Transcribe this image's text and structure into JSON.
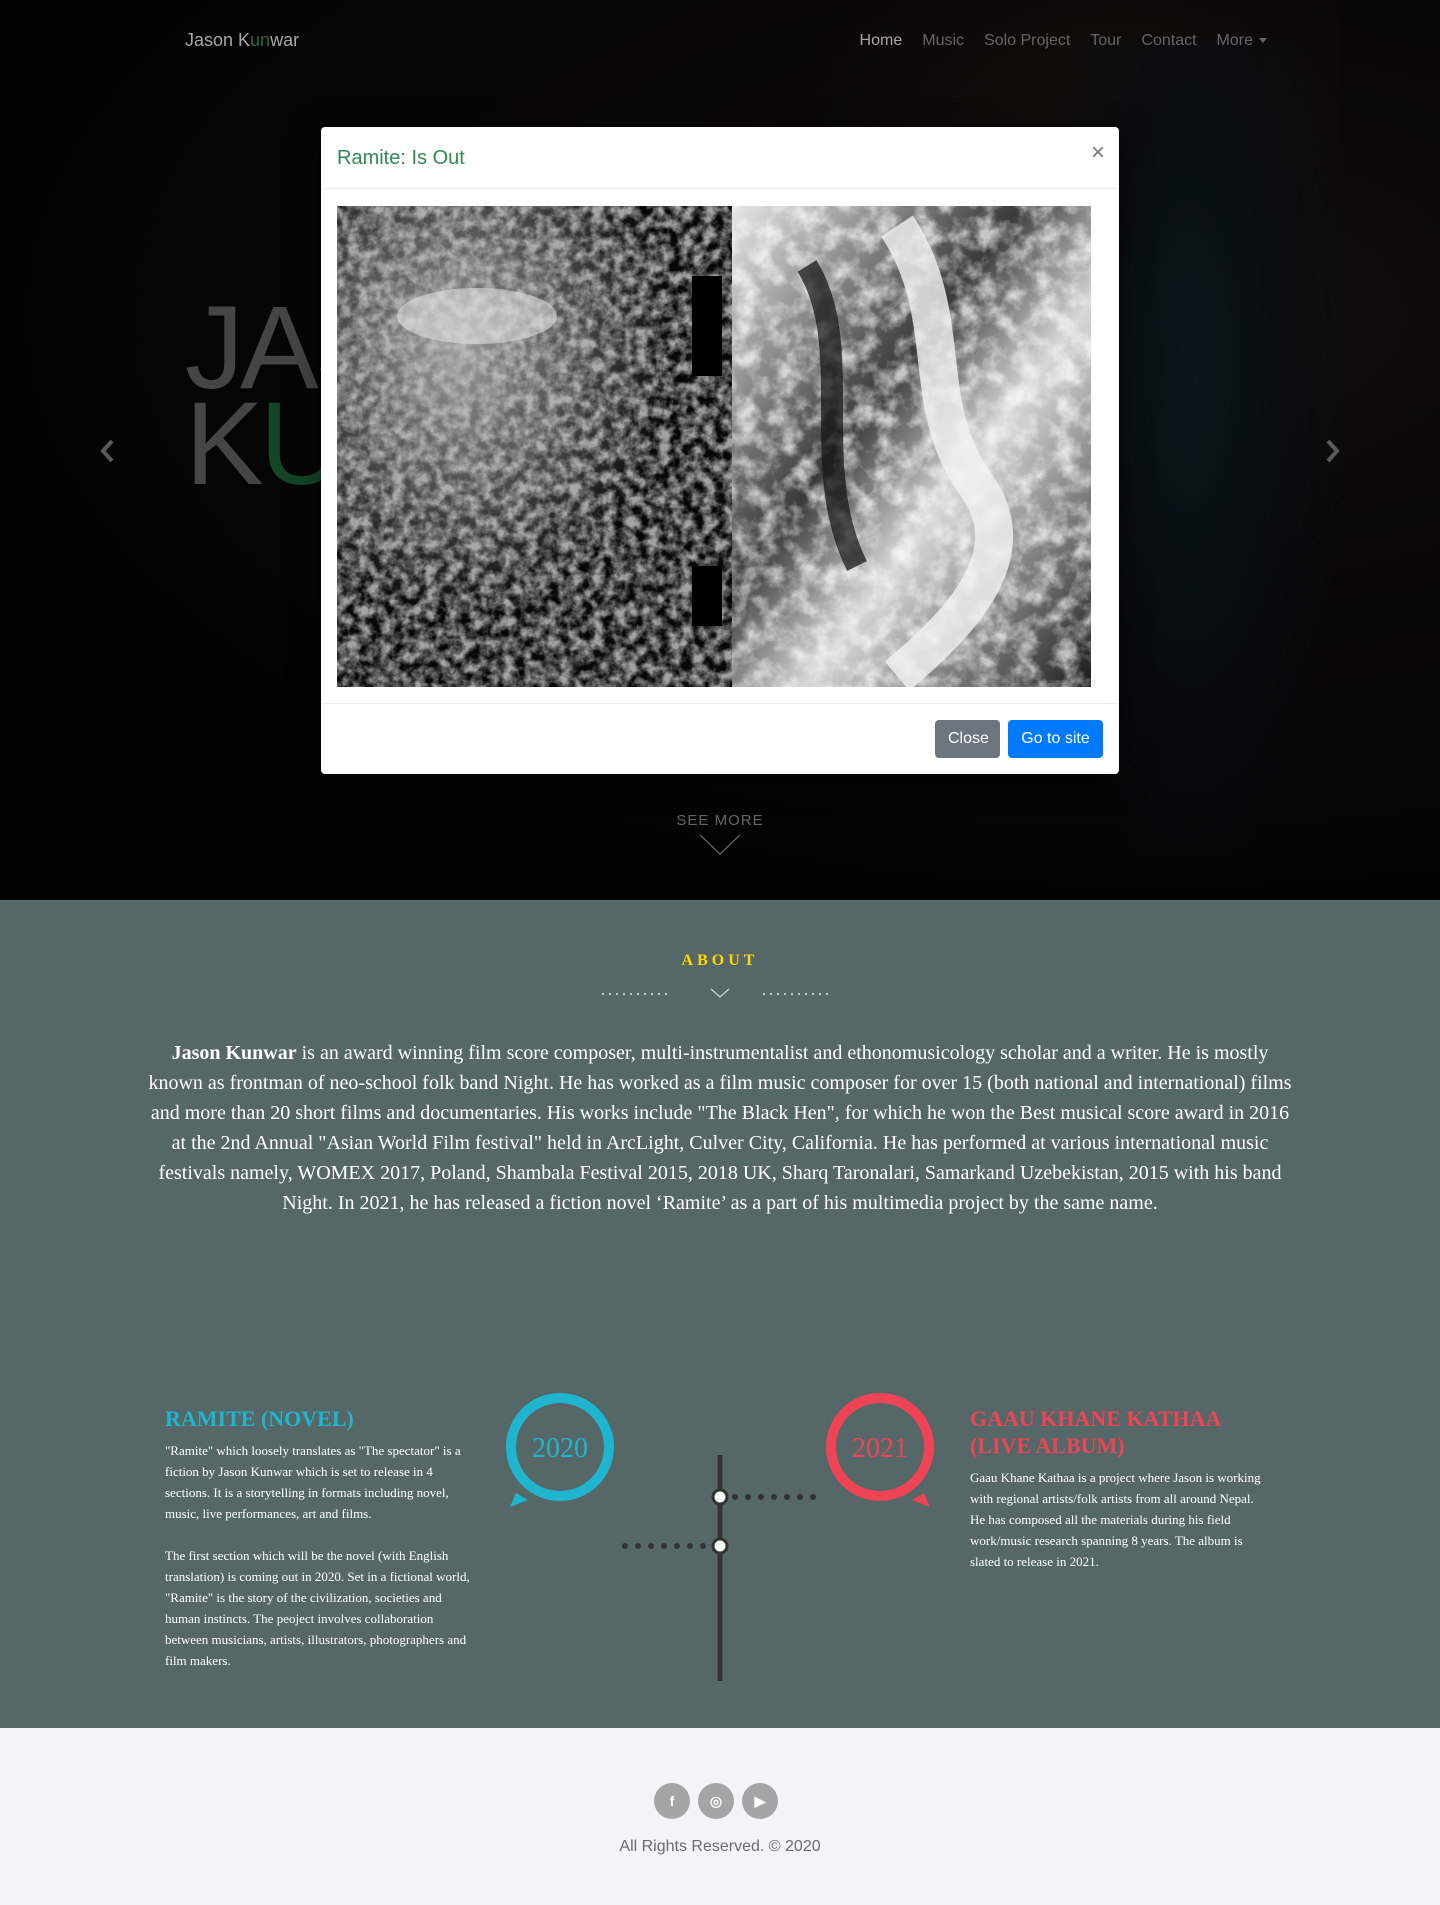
{
  "navbar": {
    "brand_prefix": "Jason K",
    "brand_accent": "un",
    "brand_suffix": "war",
    "items": [
      {
        "label": "Home",
        "active": true
      },
      {
        "label": "Music"
      },
      {
        "label": "Solo Project"
      },
      {
        "label": "Tour"
      },
      {
        "label": "Contact"
      },
      {
        "label": "More"
      }
    ]
  },
  "hero": {
    "title_line1": "JAS",
    "title_line2_a": "K",
    "title_line2_b": "U",
    "see_more": "SEE MORE"
  },
  "modal": {
    "title": "Ramite: Is Out",
    "close_symbol": "×",
    "close_button": "Close",
    "go_button": "Go to site"
  },
  "about": {
    "heading": "ABOUT",
    "name": "Jason Kunwar",
    "text": " is an award winning film score composer, multi-instrumentalist and ethonomusicology scholar and a writer. He is mostly known as frontman of neo-school folk band Night. He has worked as a film music composer for over 15 (both national and international) films and more than 20 short films and documentaries. His works include \"The Black Hen\", for which he won the Best musical score award in 2016 at the 2nd Annual \"Asian World Film festival\" held in ArcLight, Culver City, California. He has performed at various international music festivals namely, WOMEX 2017, Poland, Shambala Festival 2015, 2018 UK, Sharq Taronalari, Samarkand Uzebekistan, 2015 with his band Night. In 2021, he has released a fiction novel ‘Ramite’ as a part of his multimedia project by the same name."
  },
  "timeline": {
    "left": {
      "year": "2020",
      "title": "RAMITE (NOVEL)",
      "p1": "\"Ramite\" which loosely translates as \"The spectator\" is a fiction by Jason Kunwar which is set to release in 4 sections. It is a storytelling in formats including novel, music, live performances, art and films.",
      "p2": "The first section which will be the novel (with English translation) is coming out in 2020. Set in a fictional world, \"Ramite\" is the story of the civilization, societies and human instincts. The peoject involves collaboration between musicians, artists, illustrators, photographers and film makers."
    },
    "right": {
      "year": "2021",
      "title": "GAAU KHANE KATHAA (LIVE ALBUM)",
      "p1": "Gaau Khane Kathaa is a project where Jason is working with regional artists/folk artists from all around Nepal. He has composed all the materials during his field work/music research spanning 8 years. The album is slated to release in 2021."
    }
  },
  "footer": {
    "social": [
      {
        "icon": "facebook-icon",
        "glyph": "f"
      },
      {
        "icon": "instagram-icon",
        "glyph": "◎"
      },
      {
        "icon": "youtube-icon",
        "glyph": "▶"
      }
    ],
    "copyright": "All Rights Reserved. © 2020"
  },
  "colors": {
    "brand_green": "#2e8b4e",
    "about_bg": "#566767",
    "about_heading": "#ffd700",
    "timeline_blue": "#1fb5cf",
    "timeline_red": "#ee4455",
    "btn_secondary": "#6c757d",
    "btn_primary": "#007bff"
  }
}
